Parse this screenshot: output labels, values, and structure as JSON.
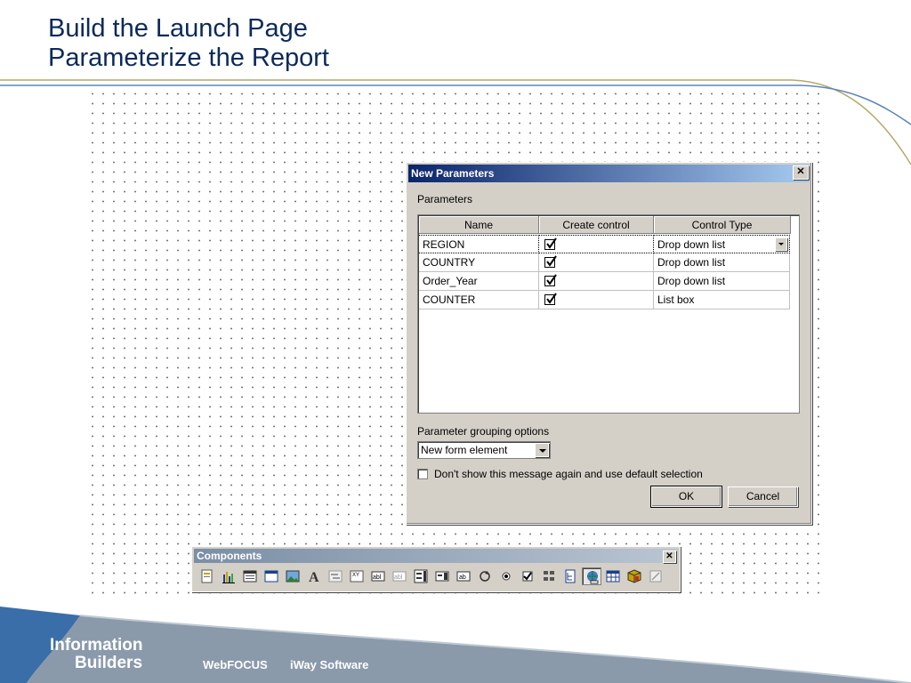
{
  "slide": {
    "title_line1": "Build the Launch Page",
    "title_line2": "Parameterize the Report"
  },
  "dialog": {
    "title": "New Parameters",
    "close_glyph": "✕",
    "params_label": "Parameters",
    "columns": [
      "Name",
      "Create control",
      "Control Type"
    ],
    "rows": [
      {
        "name": "REGION",
        "create_control": true,
        "control_type": "Drop down list"
      },
      {
        "name": "COUNTRY",
        "create_control": true,
        "control_type": "Drop down list"
      },
      {
        "name": "Order_Year",
        "create_control": true,
        "control_type": "Drop down list"
      },
      {
        "name": "COUNTER",
        "create_control": true,
        "control_type": "List box"
      }
    ],
    "grouping_label": "Parameter grouping options",
    "grouping_value": "New form element",
    "dont_show_label": "Don't show this message again and use default selection",
    "dont_show_checked": false,
    "ok_label": "OK",
    "cancel_label": "Cancel"
  },
  "components": {
    "title": "Components",
    "close_glyph": "✕",
    "tools": [
      "html-page-icon",
      "chart-icon",
      "report-icon",
      "frame-icon",
      "image-icon",
      "text-icon",
      "gantt-icon",
      "xy-icon",
      "textbox-icon",
      "textarea-icon",
      "listbox-icon",
      "dropdown-icon",
      "edit-icon",
      "reset-icon",
      "radio-icon",
      "checkbox-icon",
      "tree-icon",
      "hyperlink-tree-icon",
      "globe-link-icon",
      "table-icon",
      "cube-icon",
      "line-icon"
    ],
    "tools_pressed": "globe-link-icon"
  },
  "footer": {
    "logo_line1": "Information",
    "logo_line2": "Builders",
    "brand1": "WebFOCUS",
    "brand2": "iWay Software"
  },
  "colors": {
    "title_text": "#0b2a5a",
    "dialog_title_start": "#0a246a",
    "dialog_title_end": "#a6caf0",
    "footer_blue": "#3a6ea8",
    "footer_gray": "#8a9aab"
  }
}
